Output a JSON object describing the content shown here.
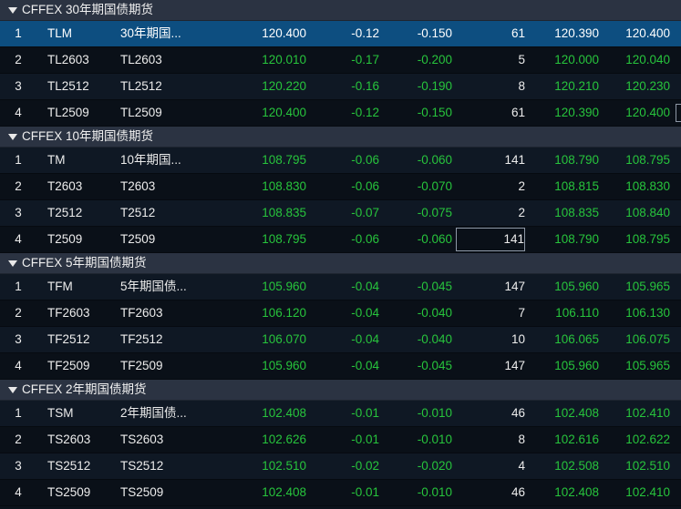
{
  "groups": [
    {
      "title": "CFFEX 30年期国债期货",
      "rows": [
        {
          "idx": "1",
          "code": "TLM",
          "name": "30年期国...",
          "last": "120.400",
          "chg": "-0.12",
          "pct": "-0.150",
          "vol": "61",
          "bid": "120.390",
          "ask": "120.400"
        },
        {
          "idx": "2",
          "code": "TL2603",
          "name": "TL2603",
          "last": "120.010",
          "chg": "-0.17",
          "pct": "-0.200",
          "vol": "5",
          "bid": "120.000",
          "ask": "120.040"
        },
        {
          "idx": "3",
          "code": "TL2512",
          "name": "TL2512",
          "last": "120.220",
          "chg": "-0.16",
          "pct": "-0.190",
          "vol": "8",
          "bid": "120.210",
          "ask": "120.230"
        },
        {
          "idx": "4",
          "code": "TL2509",
          "name": "TL2509",
          "last": "120.400",
          "chg": "-0.12",
          "pct": "-0.150",
          "vol": "61",
          "bid": "120.390",
          "ask": "120.400"
        }
      ]
    },
    {
      "title": "CFFEX 10年期国债期货",
      "rows": [
        {
          "idx": "1",
          "code": "TM",
          "name": "10年期国...",
          "last": "108.795",
          "chg": "-0.06",
          "pct": "-0.060",
          "vol": "141",
          "bid": "108.790",
          "ask": "108.795"
        },
        {
          "idx": "2",
          "code": "T2603",
          "name": "T2603",
          "last": "108.830",
          "chg": "-0.06",
          "pct": "-0.070",
          "vol": "2",
          "bid": "108.815",
          "ask": "108.830"
        },
        {
          "idx": "3",
          "code": "T2512",
          "name": "T2512",
          "last": "108.835",
          "chg": "-0.07",
          "pct": "-0.075",
          "vol": "2",
          "bid": "108.835",
          "ask": "108.840"
        },
        {
          "idx": "4",
          "code": "T2509",
          "name": "T2509",
          "last": "108.795",
          "chg": "-0.06",
          "pct": "-0.060",
          "vol": "141",
          "bid": "108.790",
          "ask": "108.795"
        }
      ]
    },
    {
      "title": "CFFEX 5年期国债期货",
      "rows": [
        {
          "idx": "1",
          "code": "TFM",
          "name": "5年期国债...",
          "last": "105.960",
          "chg": "-0.04",
          "pct": "-0.045",
          "vol": "147",
          "bid": "105.960",
          "ask": "105.965"
        },
        {
          "idx": "2",
          "code": "TF2603",
          "name": "TF2603",
          "last": "106.120",
          "chg": "-0.04",
          "pct": "-0.040",
          "vol": "7",
          "bid": "106.110",
          "ask": "106.130"
        },
        {
          "idx": "3",
          "code": "TF2512",
          "name": "TF2512",
          "last": "106.070",
          "chg": "-0.04",
          "pct": "-0.040",
          "vol": "10",
          "bid": "106.065",
          "ask": "106.075"
        },
        {
          "idx": "4",
          "code": "TF2509",
          "name": "TF2509",
          "last": "105.960",
          "chg": "-0.04",
          "pct": "-0.045",
          "vol": "147",
          "bid": "105.960",
          "ask": "105.965"
        }
      ]
    },
    {
      "title": "CFFEX 2年期国债期货",
      "rows": [
        {
          "idx": "1",
          "code": "TSM",
          "name": "2年期国债...",
          "last": "102.408",
          "chg": "-0.01",
          "pct": "-0.010",
          "vol": "46",
          "bid": "102.408",
          "ask": "102.410"
        },
        {
          "idx": "2",
          "code": "TS2603",
          "name": "TS2603",
          "last": "102.626",
          "chg": "-0.01",
          "pct": "-0.010",
          "vol": "8",
          "bid": "102.616",
          "ask": "102.622"
        },
        {
          "idx": "3",
          "code": "TS2512",
          "name": "TS2512",
          "last": "102.510",
          "chg": "-0.02",
          "pct": "-0.020",
          "vol": "4",
          "bid": "102.508",
          "ask": "102.510"
        },
        {
          "idx": "4",
          "code": "TS2509",
          "name": "TS2509",
          "last": "102.408",
          "chg": "-0.01",
          "pct": "-0.010",
          "vol": "46",
          "bid": "102.408",
          "ask": "102.410"
        }
      ]
    }
  ],
  "colors": {
    "up_down_green": "#27c43c",
    "neutral_white": "#ececec",
    "selected_row": "#0d4e80",
    "group_header_bg": "#2b3342"
  },
  "icons": {
    "group_toggle": "collapse-triangle-icon"
  }
}
